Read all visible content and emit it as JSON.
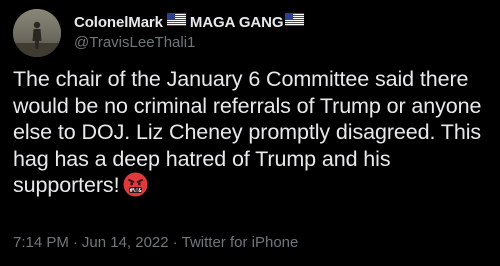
{
  "tweet": {
    "display_name": "ColonelMark",
    "display_name_suffix": "MAGA GANG",
    "handle": "@TravisLeeThali1",
    "text": "The chair of the January 6 Committee said there would be no criminal referrals of Trump or anyone else to DOJ. Liz Cheney promptly disagreed. This hag has a deep hatred of Trump and his supporters!",
    "emoji": "face-with-symbols-on-mouth",
    "time": "7:14 PM",
    "date": "Jun 14, 2022",
    "source": "Twitter for iPhone",
    "separator": "·"
  },
  "icons": {
    "flag": "us-flag-icon",
    "avatar": "avatar"
  },
  "colors": {
    "background": "#000000",
    "primary_text": "#e7e9ea",
    "secondary_text": "#71767b",
    "emoji_red": "#e0383b"
  }
}
